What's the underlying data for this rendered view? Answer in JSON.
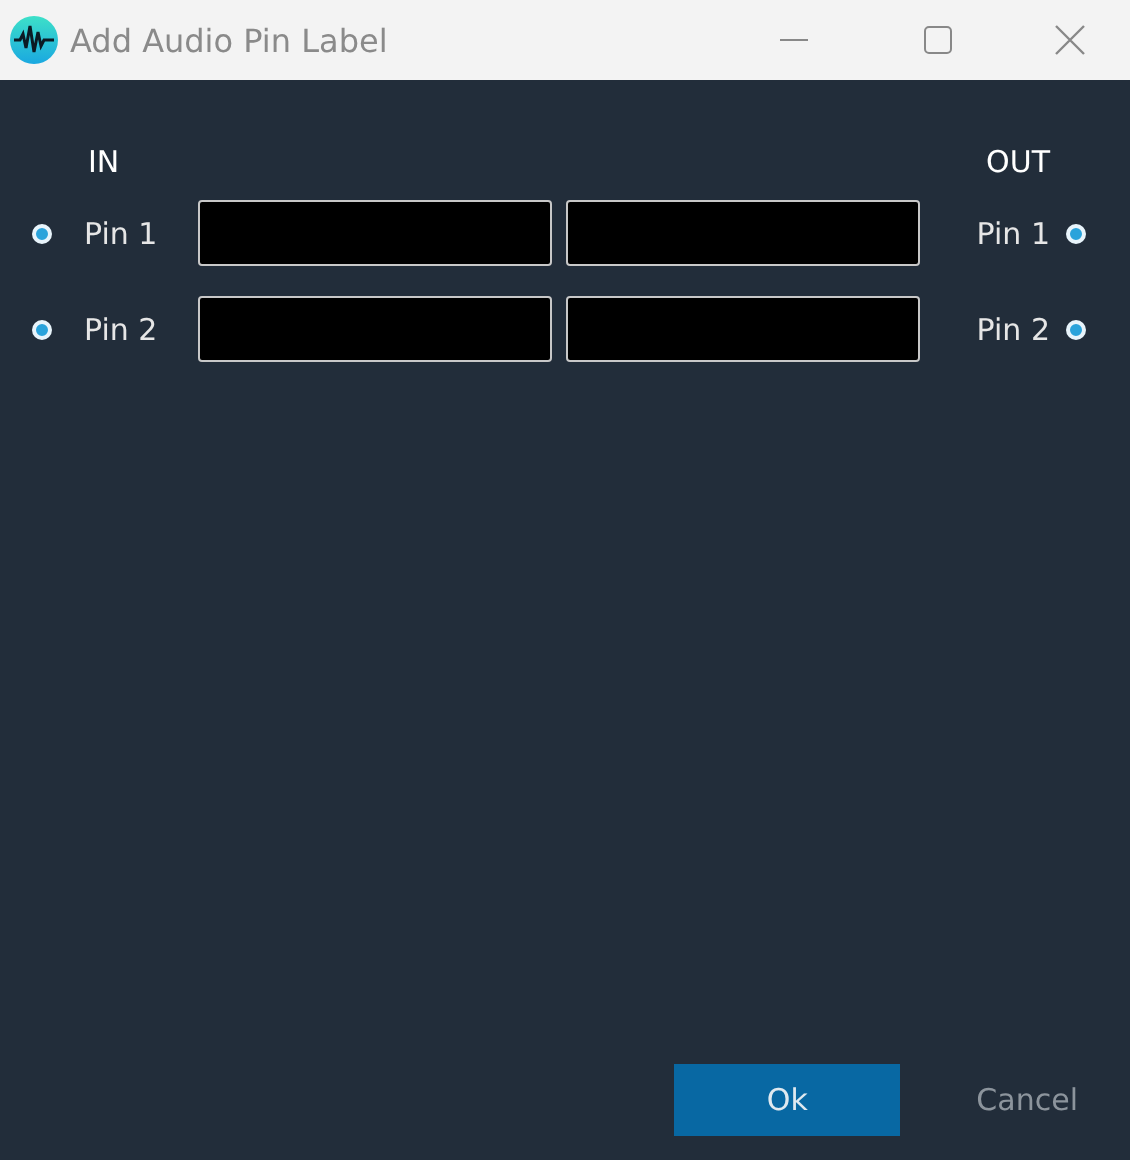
{
  "window": {
    "title": "Add Audio Pin Label"
  },
  "headers": {
    "in": "IN",
    "out": "OUT"
  },
  "pins": [
    {
      "in_label": "Pin 1",
      "out_label": "Pin 1"
    },
    {
      "in_label": "Pin 2",
      "out_label": "Pin 2"
    }
  ],
  "buttons": [
    {
      "label": "Ok",
      "kind": "primary"
    },
    {
      "label": "Cancel",
      "kind": "flat"
    }
  ]
}
